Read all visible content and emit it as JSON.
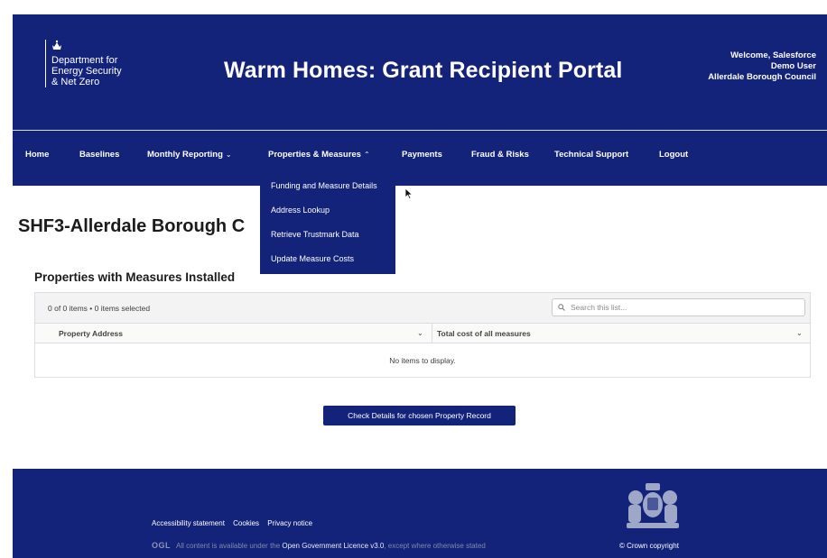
{
  "header": {
    "crest_icon": "royal-crest-icon",
    "department": "Department for\nEnergy Security\n& Net Zero",
    "title": "Warm Homes: Grant Recipient Portal",
    "welcome_line1": "Welcome, Salesforce",
    "welcome_line2": "Demo User",
    "welcome_line3": "Allerdale Borough Council"
  },
  "nav": {
    "items": [
      {
        "label": "Home"
      },
      {
        "label": "Baselines"
      },
      {
        "label": "Monthly Reporting",
        "chevron": "chevron-down-icon"
      },
      {
        "label": "Properties & Measures",
        "chevron": "chevron-up-icon"
      },
      {
        "label": "Payments"
      },
      {
        "label": "Fraud & Risks"
      },
      {
        "label": "Technical Support"
      },
      {
        "label": "Logout"
      }
    ],
    "chevron_down": "⌄",
    "chevron_up": "⌃"
  },
  "dropdown": {
    "items": [
      {
        "label": "Funding and Measure Details"
      },
      {
        "label": "Address Lookup"
      },
      {
        "label": "Retrieve Trustmark Data"
      },
      {
        "label": "Update Measure Costs"
      }
    ]
  },
  "main": {
    "page_title": "SHF3-Allerdale Borough C",
    "section_title": "Properties with Measures Installed",
    "list": {
      "count_text": "0 of 0 items • 0 items selected",
      "search_placeholder": "Search this list...",
      "columns": [
        {
          "label": "Property Address"
        },
        {
          "label": "Total cost of all measures"
        }
      ],
      "sort_icon": "⌄",
      "empty_text": "No items to display."
    },
    "check_button": "Check Details for chosen Property Record"
  },
  "footer": {
    "links": [
      {
        "label": "Accessibility statement"
      },
      {
        "label": "Cookies"
      },
      {
        "label": "Privacy notice"
      }
    ],
    "ogl": "OGL",
    "licence_prefix": "All content is available under the ",
    "licence_link": "Open Government Licence v3.0",
    "licence_suffix": ", except where otherwise stated",
    "copyright": "© Crown copyright"
  },
  "colors": {
    "brand_blue": "#13237a",
    "border": "#d8dde6"
  }
}
